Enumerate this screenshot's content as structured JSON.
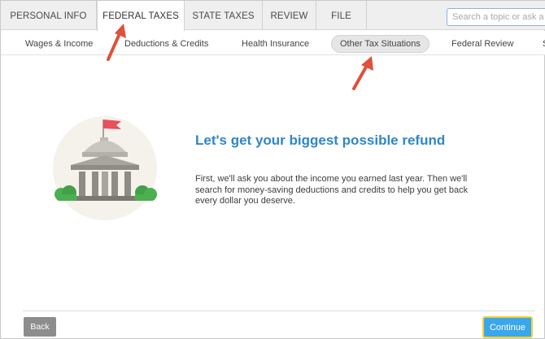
{
  "top_tabs": [
    {
      "label": "PERSONAL INFO"
    },
    {
      "label": "FEDERAL TAXES"
    },
    {
      "label": "STATE TAXES"
    },
    {
      "label": "REVIEW"
    },
    {
      "label": "FILE"
    }
  ],
  "active_top_tab": "FEDERAL TAXES",
  "search": {
    "placeholder": "Search a topic or ask a question",
    "value": ""
  },
  "sub_tabs": [
    {
      "label": "Wages & Income"
    },
    {
      "label": "Deductions & Credits"
    },
    {
      "label": "Health Insurance"
    },
    {
      "label": "Other Tax Situations"
    },
    {
      "label": "Federal Review"
    },
    {
      "label": "S"
    }
  ],
  "current_sub_tab": "Other Tax Situations",
  "main": {
    "headline": "Let's get your biggest possible refund",
    "body": "First, we'll ask you about the income you earned last year. Then we'll search for money-saving deductions and credits to help you get back every dollar you deserve."
  },
  "footer": {
    "back_label": "Back",
    "continue_label": "Continue"
  },
  "colors": {
    "headline": "#2e86c8",
    "continue_button": "#3aa7ec",
    "continue_outline": "#f2d23a",
    "back_button": "#8d8d8d",
    "annotation_arrow": "#e0503a",
    "flag": "#e8505b",
    "bushes": "#4caf50"
  },
  "icons": {
    "hero": "capitol-building-icon",
    "annotations": "red-arrow-icon"
  }
}
